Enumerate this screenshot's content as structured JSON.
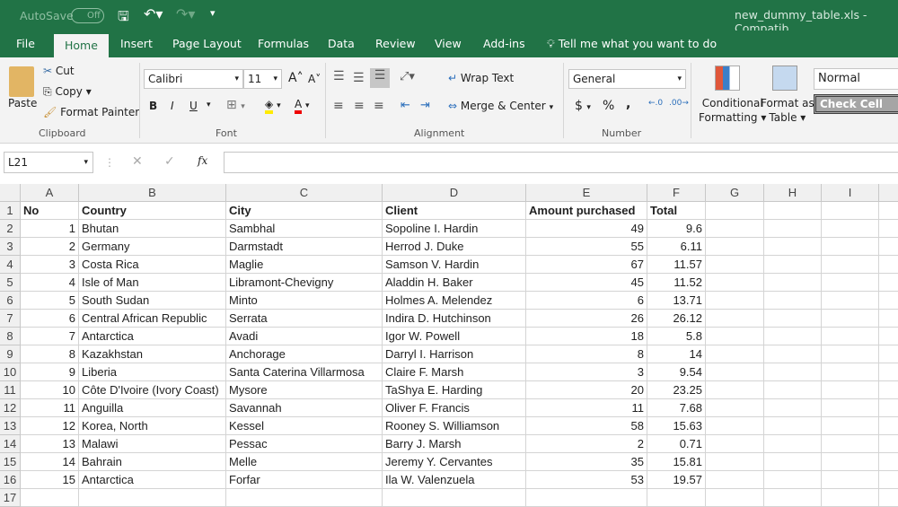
{
  "titlebar": {
    "autosave": "AutoSave",
    "autosave_state": "Off",
    "filename": "new_dummy_table.xls  -  Compatib"
  },
  "tabs": [
    "File",
    "Home",
    "Insert",
    "Page Layout",
    "Formulas",
    "Data",
    "Review",
    "View",
    "Add-ins"
  ],
  "tell_me": "Tell me what you want to do",
  "ribbon": {
    "paste": "Paste",
    "cut": "Cut",
    "copy": "Copy",
    "format_painter": "Format Painter",
    "clipboard": "Clipboard",
    "font_name": "Calibri",
    "font_size": "11",
    "bold": "B",
    "italic": "I",
    "underline": "U",
    "font": "Font",
    "wrap_text": "Wrap Text",
    "merge_center": "Merge & Center",
    "alignment": "Alignment",
    "number_format": "General",
    "currency": "$",
    "percent": "%",
    "comma": ",",
    "number": "Number",
    "conditional_formatting": [
      "Conditional",
      "Formatting"
    ],
    "format_as_table": [
      "Format as",
      "Table"
    ],
    "style_normal": "Normal",
    "style_check_cell": "Check Cell"
  },
  "formula_bar": {
    "name_box": "L21",
    "fx": "fx",
    "value": ""
  },
  "columns": [
    "A",
    "B",
    "C",
    "D",
    "E",
    "F",
    "G",
    "H",
    "I"
  ],
  "rows": [
    [
      "No",
      "Country",
      "City",
      "Client",
      "Amount purchased",
      "Total"
    ],
    [
      "1",
      "Bhutan",
      "Sambhal",
      "Sopoline I. Hardin",
      "49",
      "9.6"
    ],
    [
      "2",
      "Germany",
      "Darmstadt",
      "Herrod J. Duke",
      "55",
      "6.11"
    ],
    [
      "3",
      "Costa Rica",
      "Maglie",
      "Samson V. Hardin",
      "67",
      "11.57"
    ],
    [
      "4",
      "Isle of Man",
      "Libramont-Chevigny",
      "Aladdin H. Baker",
      "45",
      "11.52"
    ],
    [
      "5",
      "South Sudan",
      "Minto",
      "Holmes A. Melendez",
      "6",
      "13.71"
    ],
    [
      "6",
      "Central African Republic",
      "Serrata",
      "Indira D. Hutchinson",
      "26",
      "26.12"
    ],
    [
      "7",
      "Antarctica",
      "Avadi",
      "Igor W. Powell",
      "18",
      "5.8"
    ],
    [
      "8",
      "Kazakhstan",
      "Anchorage",
      "Darryl I. Harrison",
      "8",
      "14"
    ],
    [
      "9",
      "Liberia",
      "Santa Caterina Villarmosa",
      "Claire F. Marsh",
      "3",
      "9.54"
    ],
    [
      "10",
      "Côte D'Ivoire (Ivory Coast)",
      "Mysore",
      "TaShya E. Harding",
      "20",
      "23.25"
    ],
    [
      "11",
      "Anguilla",
      "Savannah",
      "Oliver F. Francis",
      "11",
      "7.68"
    ],
    [
      "12",
      "Korea, North",
      "Kessel",
      "Rooney S. Williamson",
      "58",
      "15.63"
    ],
    [
      "13",
      "Malawi",
      "Pessac",
      "Barry J. Marsh",
      "2",
      "0.71"
    ],
    [
      "14",
      "Bahrain",
      "Melle",
      "Jeremy Y. Cervantes",
      "35",
      "15.81"
    ],
    [
      "15",
      "Antarctica",
      "Forfar",
      "Ila W. Valenzuela",
      "53",
      "19.57"
    ]
  ],
  "colors": {
    "brand": "#217346",
    "grid": "#d4d4d4"
  }
}
